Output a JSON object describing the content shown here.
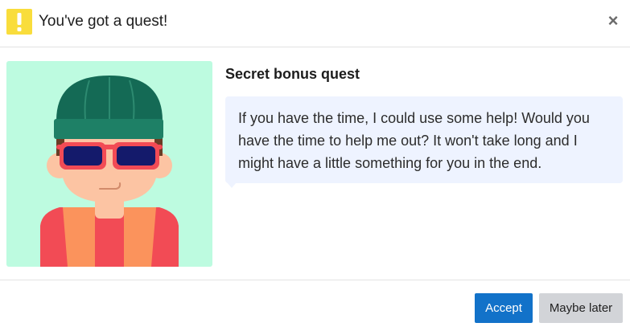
{
  "dialog": {
    "title": "You've got a quest!",
    "close_label": "×"
  },
  "quest": {
    "title": "Secret bonus quest",
    "message": "If you have the time, I could use some help! Would you have the time to help me out? It won't take long and I might have a little something for you in the end."
  },
  "buttons": {
    "accept_label": "Accept",
    "later_label": "Maybe later"
  },
  "icons": {
    "header": "warning-icon",
    "close": "close-icon",
    "portrait": "character-avatar"
  },
  "colors": {
    "warning_badge": "#f9dd3c",
    "portrait_bg": "#bdfbe0",
    "bubble_bg": "#eef3ff",
    "accept_bg": "#1272c9",
    "later_bg": "#d2d4d8"
  }
}
